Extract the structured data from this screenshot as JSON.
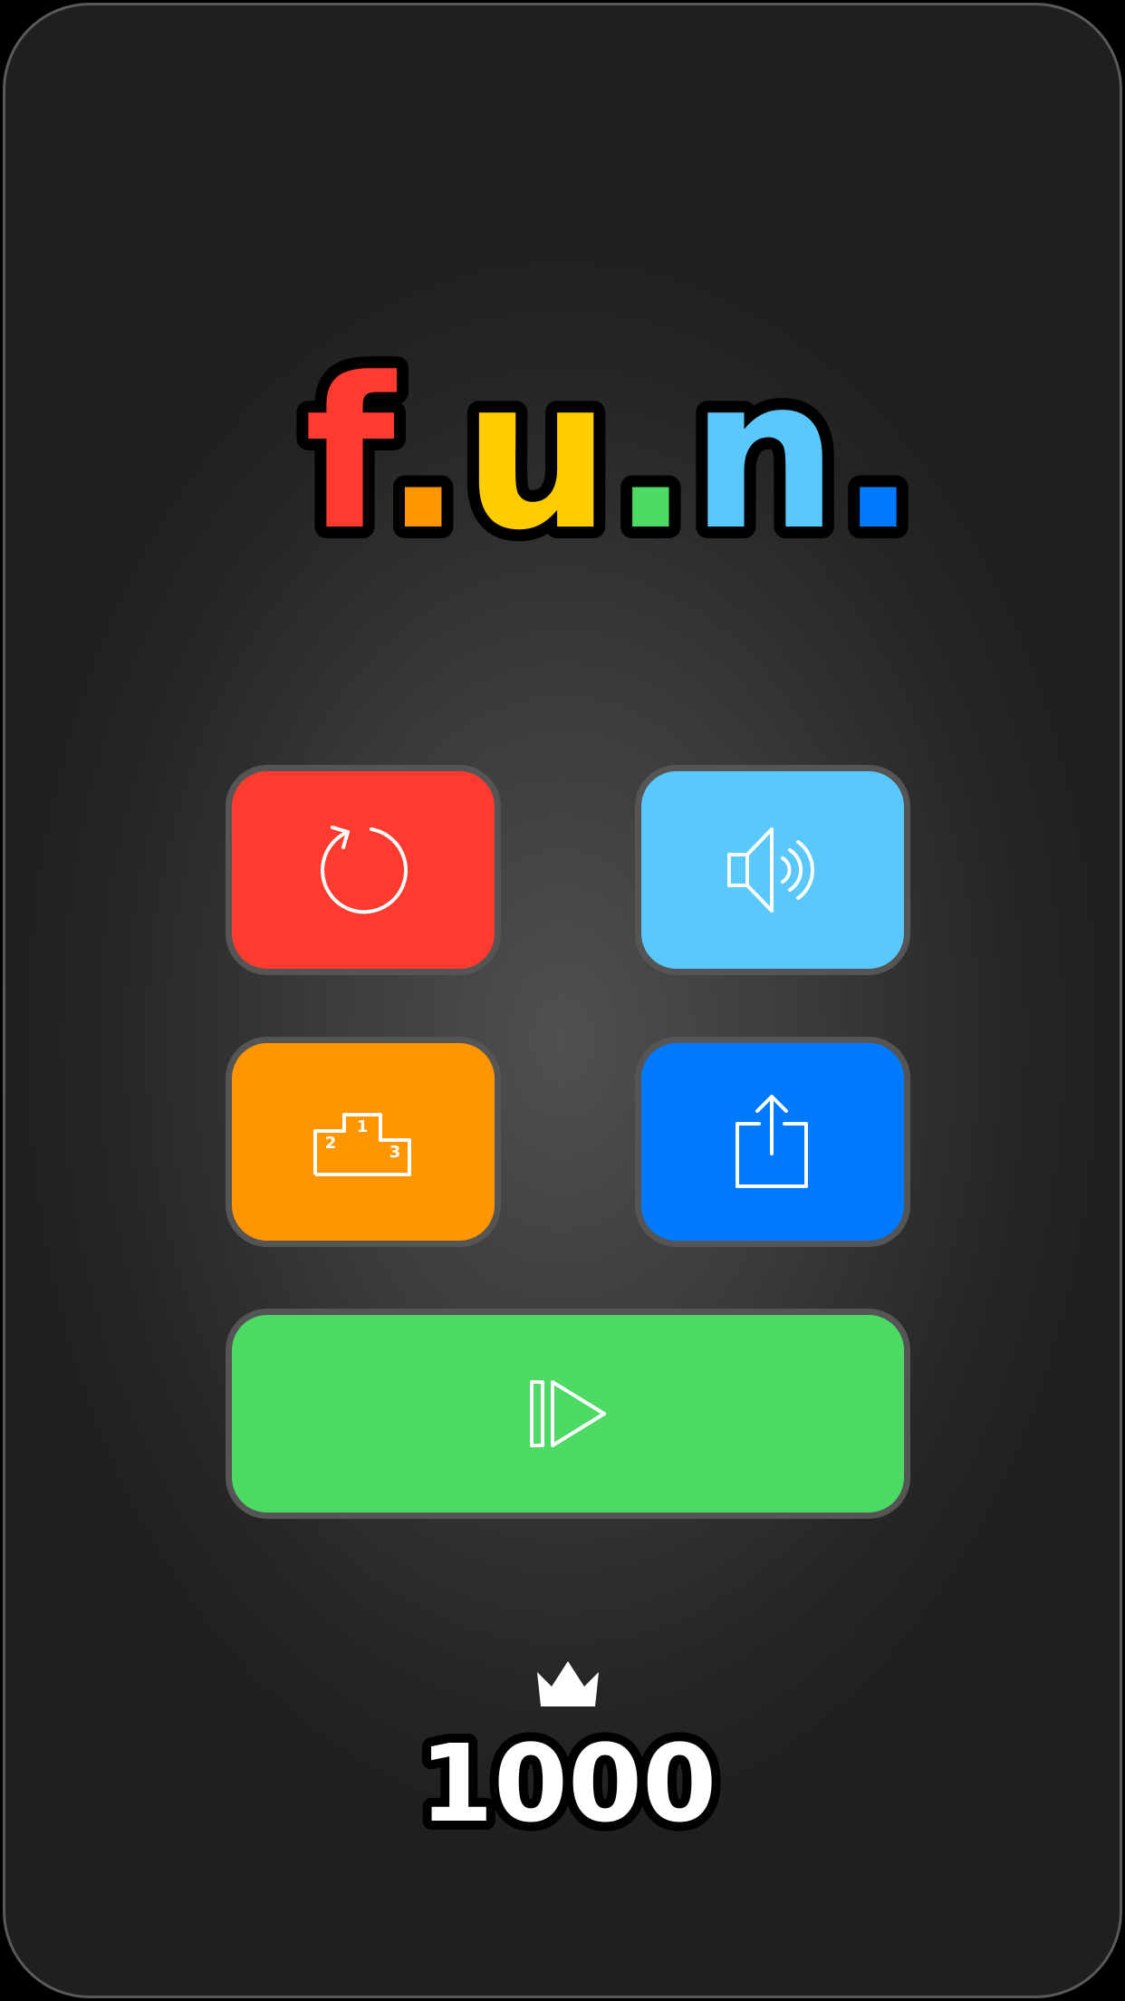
{
  "logo": {
    "parts": [
      {
        "text": "f",
        "color": "#FF3B30"
      },
      {
        "text": ".",
        "color": "#FF9500"
      },
      {
        "text": "u",
        "color": "#FFCC00"
      },
      {
        "text": ".",
        "color": "#4CD964"
      },
      {
        "text": "n",
        "color": "#5AC8FA"
      },
      {
        "text": ".",
        "color": "#007AFF"
      }
    ]
  },
  "buttons": {
    "restart": {
      "icon": "restart-icon",
      "color": "#FF3B30"
    },
    "sound": {
      "icon": "speaker-icon",
      "color": "#5AC8FA"
    },
    "leaderboard": {
      "icon": "podium-icon",
      "color": "#FF9500",
      "places": [
        "1",
        "2",
        "3"
      ]
    },
    "share": {
      "icon": "share-icon",
      "color": "#007AFF"
    },
    "play": {
      "icon": "play-icon",
      "color": "#4CD964"
    }
  },
  "best_score": {
    "icon": "crown-icon",
    "value": "1000"
  }
}
